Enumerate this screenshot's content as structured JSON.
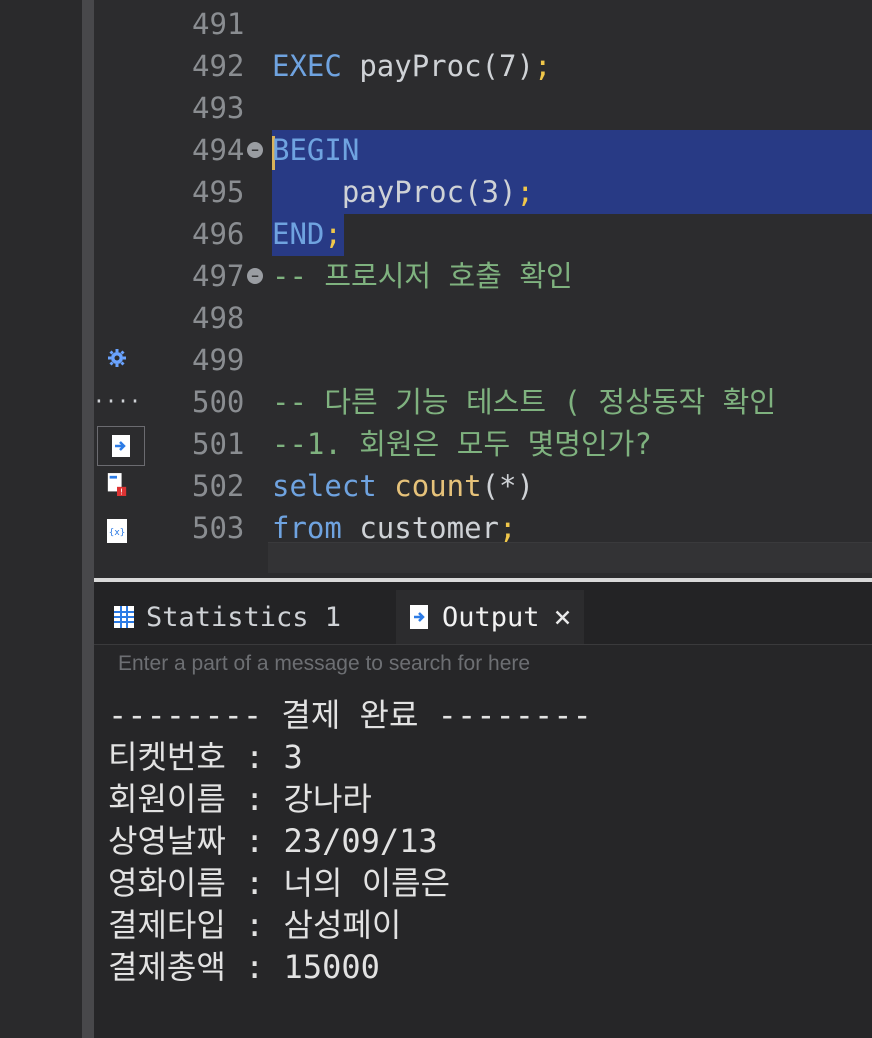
{
  "editor": {
    "lines": [
      {
        "num": "491",
        "text": ""
      },
      {
        "num": "492",
        "text": "EXEC payProc(7);"
      },
      {
        "num": "493",
        "text": ""
      },
      {
        "num": "494",
        "text": "BEGIN",
        "fold": true
      },
      {
        "num": "495",
        "text": "    payProc(3);"
      },
      {
        "num": "496",
        "text": "END;"
      },
      {
        "num": "497",
        "text": "-- 프로시저 호출 확인",
        "fold": true
      },
      {
        "num": "498",
        "text": ""
      },
      {
        "num": "499",
        "text": ""
      },
      {
        "num": "500",
        "text": "-- 다른 기능 테스트 ( 정상동작 확인"
      },
      {
        "num": "501",
        "text": "--1. 회원은 모두 몇명인가?"
      },
      {
        "num": "502",
        "text": "select count(*)"
      },
      {
        "num": "503",
        "text": "from customer;"
      }
    ]
  },
  "panel": {
    "tabs": [
      {
        "label": "Statistics 1",
        "icon": "grid-icon"
      },
      {
        "label": "Output",
        "icon": "output-icon",
        "active": true
      }
    ],
    "search_placeholder": "Enter a part of a message to search for here",
    "output_lines": [
      "-------- 결제 완료 --------",
      "티켓번호 : 3",
      "회원이름 : 강나라",
      "상영날짜 : 23/09/13",
      "영화이름 : 너의 이름은",
      "결제타입 : 삼성페이",
      "결제총액 : 15000"
    ]
  },
  "icons": [
    "gear-icon",
    "more-icon",
    "export-icon",
    "error-file-icon",
    "variables-icon"
  ],
  "colors": {
    "keyword": "#6fa3e0",
    "function": "#e6c27a",
    "comment": "#7fb27f",
    "selection": "#283a85"
  }
}
